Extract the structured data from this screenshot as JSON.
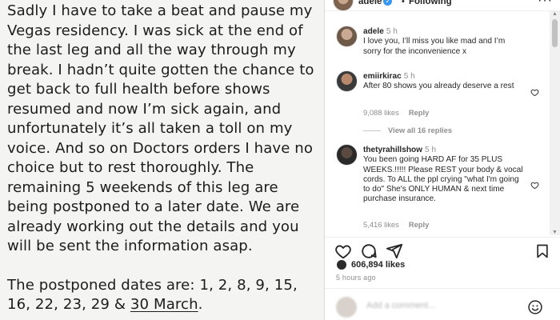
{
  "post": {
    "statement_paragraphs": [
      "Sadly I have to take a beat and pause my Vegas residency. I was sick at the end of the last leg and all the way through my break. I hadn’t quite gotten the chance to get back to full health before shows resumed and now I’m sick again, and unfortunately it’s all taken a toll on my voice. And so on Doctors orders I have no choice but to rest thoroughly. The remaining 5 weekends of this leg are being postponed to a later date. We are already working out the details and you will be sent the information asap."
    ],
    "dates_prefix": "The postponed dates are: 1, 2, 8, 9, 15, 16, 22, 23, 29 & ",
    "dates_underlined": "30 March",
    "dates_suffix": "."
  },
  "header": {
    "username": "adele",
    "verified_mark": "✓",
    "dot": "•",
    "follow_status": "Following",
    "more": "···"
  },
  "comments": [
    {
      "username": "adele",
      "time": "5 h",
      "text": "I love you, I’ll miss you like mad and I’m sorry for the inconvenience x"
    },
    {
      "username": "emiirkirac",
      "time": "5 h",
      "text": "After 80 shows you already deserve a rest",
      "likes": "9,088 likes",
      "reply": "Reply"
    },
    {
      "username": "thetyrahillshow",
      "time": "5 h",
      "text": "You been going HARD AF for 35 PLUS WEEKS.!!!!! Please REST your body & vocal cords. To ALL the ppl crying \"what I'm going to do\" She's ONLY HUMAN & next time purchase insurance.",
      "likes": "5,416 likes",
      "reply": "Reply"
    }
  ],
  "view_replies": "View all 16 replies",
  "engagement": {
    "likes_count": "606,894 likes",
    "posted": "5 hours ago"
  },
  "add_comment": {
    "placeholder": "Add a comment..."
  },
  "icons": {
    "like": "heart-icon",
    "comment": "comment-icon",
    "share": "share-icon",
    "save": "bookmark-icon",
    "emoji": "emoji-icon",
    "more": "more-icon"
  }
}
